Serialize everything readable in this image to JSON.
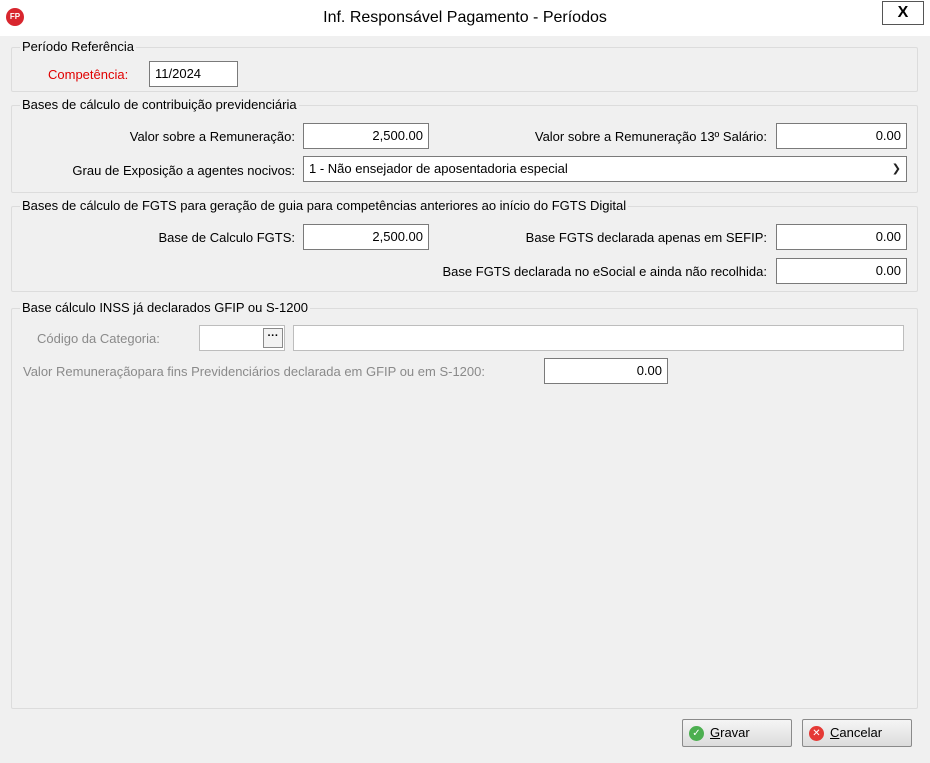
{
  "window": {
    "title": "Inf. Responsável Pagamento - Períodos",
    "close_label": "X",
    "app_icon_label": "FP"
  },
  "periodo": {
    "legend": "Período Referência",
    "competencia_label": "Competência:",
    "competencia_value": "11/2024"
  },
  "bases_contrib": {
    "legend": "Bases de cálculo de contribuição previdenciária",
    "remun_label": "Valor sobre a Remuneração:",
    "remun_value": "2,500.00",
    "remun13_label": "Valor sobre a Remuneração 13º Salário:",
    "remun13_value": "0.00",
    "grau_label": "Grau de Exposição a agentes nocivos:",
    "grau_value": "1 - Não ensejador de aposentadoria especial"
  },
  "bases_fgts": {
    "legend": "Bases de cálculo de FGTS para geração de guia para competências anteriores ao início do FGTS Digital",
    "base_label": "Base de Calculo FGTS:",
    "base_value": "2,500.00",
    "sefip_label": "Base FGTS declarada apenas em SEFIP:",
    "sefip_value": "0.00",
    "esocial_label": "Base FGTS declarada no eSocial e ainda não recolhida:",
    "esocial_value": "0.00"
  },
  "inss": {
    "legend": "Base cálculo INSS já declarados GFIP ou S-1200",
    "categoria_label": "Código da Categoria:",
    "categoria_code": "",
    "categoria_desc": "",
    "ellipsis_label": "···",
    "valor_label": "Valor Remuneraçãopara fins Previdenciários declarada em GFIP ou em S-1200:",
    "valor_value": "0.00"
  },
  "buttons": {
    "gravar_label": "Gravar",
    "cancelar_label": "Cancelar"
  },
  "colors": {
    "accent_red": "#e00000",
    "gravar_icon": "#4caf50",
    "cancelar_icon": "#e53935"
  },
  "icons": {
    "gravar": "check-circle-icon",
    "cancelar": "cancel-circle-icon",
    "app": "fp-app-icon"
  }
}
